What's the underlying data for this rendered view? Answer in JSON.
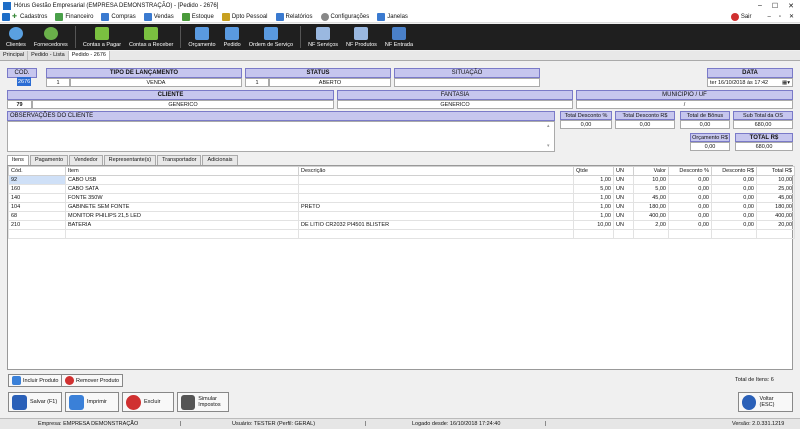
{
  "window": {
    "title": "Hórus Gestão Empresarial (EMPRESA DEMONSTRAÇÃO) - [Pedido - 2676]"
  },
  "menu": {
    "items": [
      "Cadastros",
      "Financeiro",
      "Compras",
      "Vendas",
      "Estoque",
      "Dpto Pessoal",
      "Relatórios",
      "Configurações",
      "Janelas"
    ],
    "exit": "Sair"
  },
  "toolbar": {
    "buttons": [
      "Clientes",
      "Fornecedores",
      "Contas a Pagar",
      "Contas a Receber",
      "Orçamento",
      "Pedido",
      "Ordem de Serviço",
      "NF Serviços",
      "NF Produtos",
      "NF Entrada"
    ]
  },
  "doc_tabs": [
    "Principal",
    "Pedido - Lista",
    "Pedido - 2676"
  ],
  "header": {
    "cod_label": "COD.",
    "cod_value": "2676",
    "tipo_label": "TIPO DE LANÇAMENTO",
    "tipo_code": "1",
    "tipo_value": "VENDA",
    "status_label": "STATUS",
    "status_code": "1",
    "status_value": "ABERTO",
    "situacao_label": "SITUAÇÃO",
    "situacao_value": "",
    "data_label": "DATA",
    "data_value": "ter 16/10/2018 às 17:42",
    "cliente_label": "CLIENTE",
    "cliente_code": "79",
    "cliente_value": "GENERICO",
    "fantasia_label": "FANTASIA",
    "fantasia_value": "GENERICO",
    "municipio_label": "MUNICIPIO / UF",
    "municipio_value": "/"
  },
  "obs": {
    "label": "OBSERVAÇÕES DO CLIENTE",
    "value": ""
  },
  "totals": {
    "total_desc_pct_label": "Total Desconto %",
    "total_desc_pct": "0,00",
    "total_desc_rs_label": "Total Desconto R$",
    "total_desc_rs": "0,00",
    "total_bonus_label": "Total de Bônus",
    "total_bonus": "0,00",
    "subtotal_label": "Sub Total da OS",
    "subtotal": "680,00",
    "orcamento_label": "Orçamento R$",
    "orcamento": "0,00",
    "total_label": "TOTAL R$",
    "total": "680,00"
  },
  "inner_tabs": [
    "Itens",
    "Pagamento",
    "Vendedor",
    "Representante(s)",
    "Transportador",
    "Adicionais"
  ],
  "grid": {
    "columns": [
      "Cód.",
      "Item",
      "Descrição",
      "Qtde",
      "UN",
      "Valor",
      "Desconto %",
      "Desconto R$",
      "Total R$"
    ],
    "rows": [
      [
        "92",
        "CABO USB",
        "",
        "1,00",
        "UN",
        "10,00",
        "0,00",
        "0,00",
        "10,00"
      ],
      [
        "160",
        "CABO SATA",
        "",
        "5,00",
        "UN",
        "5,00",
        "0,00",
        "0,00",
        "25,00"
      ],
      [
        "140",
        "FONTE 350W",
        "",
        "1,00",
        "UN",
        "45,00",
        "0,00",
        "0,00",
        "45,00"
      ],
      [
        "104",
        "GABINETE SEM FONTE",
        "PRETO",
        "1,00",
        "UN",
        "180,00",
        "0,00",
        "0,00",
        "180,00"
      ],
      [
        "68",
        "MONITOR PHILIPS 21,5 LED",
        "",
        "1,00",
        "UN",
        "400,00",
        "0,00",
        "0,00",
        "400,00"
      ],
      [
        "210",
        "BATERIA",
        "DE LITIO CR2032 PI4501 BLISTER",
        "10,00",
        "UN",
        "2,00",
        "0,00",
        "0,00",
        "20,00"
      ]
    ]
  },
  "item_buttons": {
    "add": "Incluir Produto",
    "remove": "Remover Produto"
  },
  "total_items": "Total de Itens: 6",
  "actions": {
    "save": "Salvar (F1)",
    "print": "Imprimir",
    "delete": "Excluir",
    "simulate": "Simular Impostos",
    "back": "Voltar (ESC)"
  },
  "status": {
    "empresa": "Empresa: EMPRESA DEMONSTRAÇÃO",
    "usuario": "Usuário: TESTER (Perfil: GERAL)",
    "logado": "Logado desde: 16/10/2018 17:24:40",
    "versao": "Versão: 2.0.331.1219"
  },
  "colors": {
    "toolbar_bg": "#1f1f1f",
    "panel_header": "#c6c6ee",
    "panel_border": "#7a7ac8",
    "selection": "#2b6cd4"
  }
}
